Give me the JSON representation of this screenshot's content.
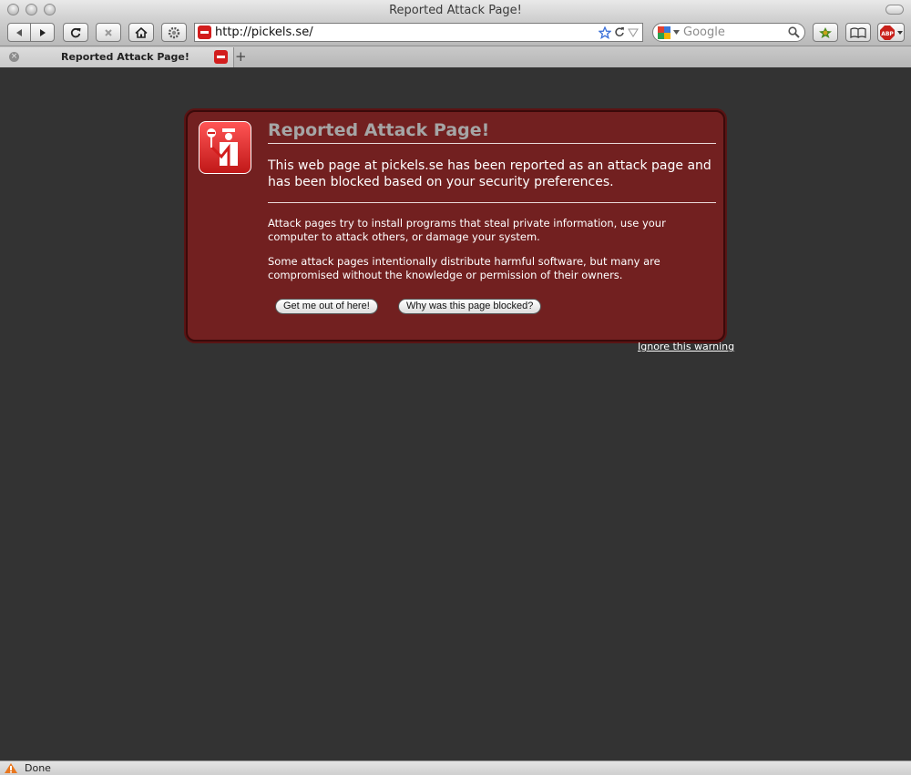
{
  "window": {
    "title": "Reported Attack Page!"
  },
  "toolbar": {
    "url": "http://pickels.se/",
    "search_placeholder": "Google"
  },
  "tabs": [
    {
      "label": "Reported Attack Page!"
    }
  ],
  "error_page": {
    "title": "Reported Attack Page!",
    "short_desc": "This web page at pickels.se has been reported as an attack page and has been blocked based on your security preferences.",
    "long_desc_1": "Attack pages try to install programs that steal private information, use your computer to attack others, or damage your system.",
    "long_desc_2": "Some attack pages intentionally distribute harmful software, but many are compromised without the knowledge or permission of their owners.",
    "buttons": {
      "get_out": "Get me out of here!",
      "why_blocked": "Why was this page blocked?"
    },
    "ignore_link": "Ignore this warning"
  },
  "statusbar": {
    "text": "Done"
  },
  "colors": {
    "page_bg": "#333333",
    "error_box": "#722020",
    "error_border": "#3a0a0a",
    "badge_red": "#d21d1d"
  }
}
